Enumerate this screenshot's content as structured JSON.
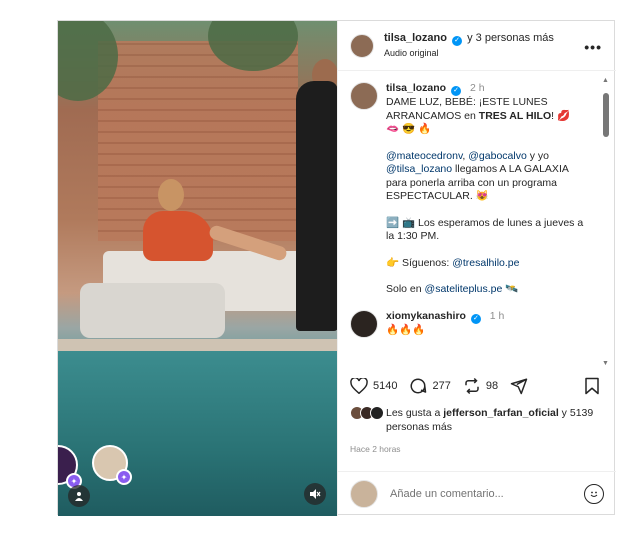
{
  "header": {
    "username": "tilsa_lozano",
    "coauthors": "y 3 personas más",
    "audio": "Audio original",
    "more": "•••"
  },
  "caption": {
    "username": "tilsa_lozano",
    "time": "2 h",
    "line1_pre": "DAME LUZ, BEBÉ: ¡ESTE LUNES ARRANCAMOS en ",
    "line1_bold": "TRES AL HILO",
    "line1_post": "! 💋",
    "line1_emojis": "🫦 😎 🔥",
    "mention1": "@mateocedronv",
    "sep1": ", ",
    "mention2": "@gabocalvo",
    "sep2": " y yo ",
    "mention3": "@tilsa_lozano",
    "para2_rest": " llegamos A LA GALAXIA para ponerla arriba con un programa ESPECTACULAR. 😻",
    "para3": "➡️ 📺 Los esperamos de lunes a jueves a la 1:30 PM.",
    "para4_pre": "👉 Síguenos: ",
    "para4_mention": "@tresalhilo.pe",
    "para5_pre": "Solo en ",
    "para5_mention": "@sateliteplus.pe",
    "para5_post": " 🛰️"
  },
  "comment": {
    "username": "xiomykanashiro",
    "time": "1 h",
    "text": "🔥🔥🔥"
  },
  "actions": {
    "likes": "5140",
    "comments": "277",
    "shares": "98"
  },
  "liked_by": {
    "prefix": "Les gusta a ",
    "user": "jefferson_farfan_oficial",
    "suffix": " y 5139 personas más"
  },
  "posted": "Hace 2 horas",
  "add_comment": {
    "placeholder": "Añade un comentario..."
  },
  "colors": {
    "link": "#00376b",
    "verified": "#0095f6",
    "muted": "#8e8e8e"
  }
}
